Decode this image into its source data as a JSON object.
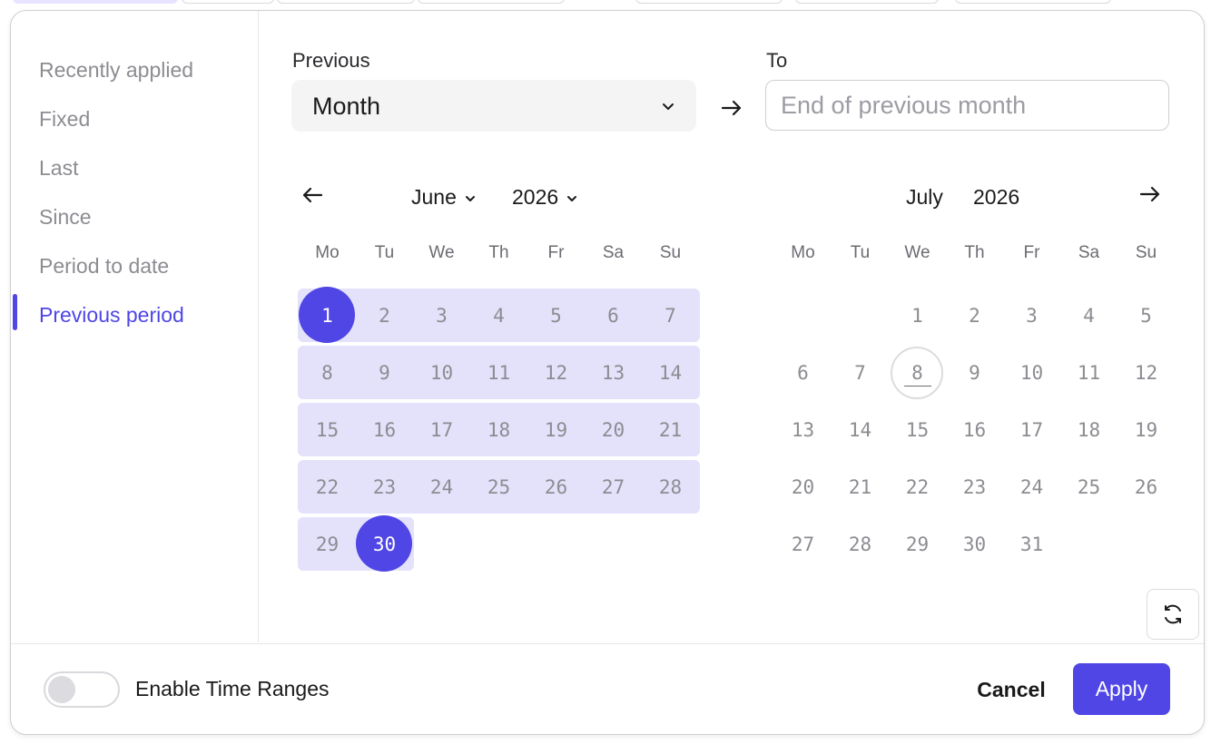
{
  "sidebar": {
    "items": [
      {
        "label": "Recently applied"
      },
      {
        "label": "Fixed"
      },
      {
        "label": "Last"
      },
      {
        "label": "Since"
      },
      {
        "label": "Period to date"
      },
      {
        "label": "Previous period",
        "active": true
      }
    ]
  },
  "range": {
    "previous_label": "Previous",
    "previous_value": "Month",
    "to_label": "To",
    "to_placeholder": "End of previous month"
  },
  "calendar": {
    "weekdays": [
      "Mo",
      "Tu",
      "We",
      "Th",
      "Fr",
      "Sa",
      "Su"
    ],
    "left": {
      "month": "June",
      "year": "2026",
      "first_weekday": 0,
      "days_in_month": 30,
      "range_start": 1,
      "range_end": 30
    },
    "right": {
      "month": "July",
      "year": "2026",
      "first_weekday": 2,
      "days_in_month": 31,
      "today": 8
    }
  },
  "footer": {
    "toggle_label": "Enable Time Ranges",
    "toggle_on": false,
    "cancel_label": "Cancel",
    "apply_label": "Apply"
  },
  "colors": {
    "accent": "#4f46e5",
    "range_band": "#e4e2fb"
  }
}
